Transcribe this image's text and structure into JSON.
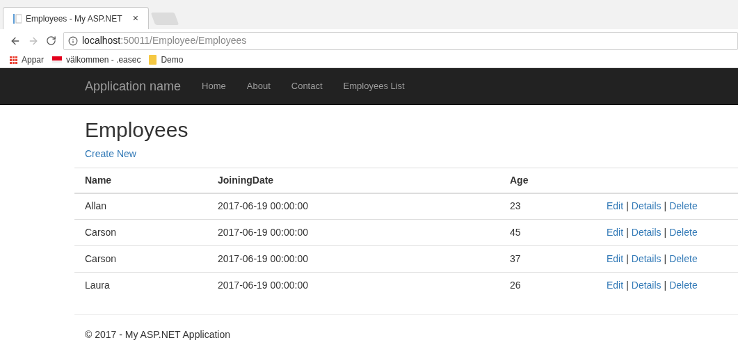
{
  "browser": {
    "tab_title": "Employees - My ASP.NET",
    "tab_close": "×",
    "address_host": "localhost",
    "address_path": ":50011/Employee/Employees",
    "bookmarks": [
      {
        "label": "Appar",
        "kind": "apps"
      },
      {
        "label": "välkommen - .easec",
        "kind": "flag"
      },
      {
        "label": "Demo",
        "kind": "folder"
      }
    ]
  },
  "navbar": {
    "brand": "Application name",
    "links": [
      "Home",
      "About",
      "Contact",
      "Employees List"
    ]
  },
  "page": {
    "title": "Employees",
    "create_link": "Create New"
  },
  "table": {
    "columns": [
      "Name",
      "JoiningDate",
      "Age"
    ],
    "rows": [
      {
        "cells": [
          "Allan",
          "2017-06-19 00:00:00",
          "23"
        ],
        "actions": [
          {
            "kind": "link",
            "text": "Edit"
          },
          {
            "kind": "separator",
            "text": "|"
          },
          {
            "kind": "link",
            "text": "Details"
          },
          {
            "kind": "separator",
            "text": "|"
          },
          {
            "kind": "link",
            "text": "Delete"
          }
        ]
      },
      {
        "cells": [
          "Carson",
          "2017-06-19 00:00:00",
          "45"
        ],
        "actions": [
          {
            "kind": "link",
            "text": "Edit"
          },
          {
            "kind": "separator",
            "text": "|"
          },
          {
            "kind": "link",
            "text": "Details"
          },
          {
            "kind": "separator",
            "text": "|"
          },
          {
            "kind": "link",
            "text": "Delete"
          }
        ]
      },
      {
        "cells": [
          "Carson",
          "2017-06-19 00:00:00",
          "37"
        ],
        "actions": [
          {
            "kind": "link",
            "text": "Edit"
          },
          {
            "kind": "separator",
            "text": "|"
          },
          {
            "kind": "link",
            "text": "Details"
          },
          {
            "kind": "separator",
            "text": "|"
          },
          {
            "kind": "link",
            "text": "Delete"
          }
        ]
      },
      {
        "cells": [
          "Laura",
          "2017-06-19 00:00:00",
          "26"
        ],
        "actions": [
          {
            "kind": "link",
            "text": "Edit"
          },
          {
            "kind": "separator",
            "text": "|"
          },
          {
            "kind": "link",
            "text": "Details"
          },
          {
            "kind": "separator",
            "text": "|"
          },
          {
            "kind": "link",
            "text": "Delete"
          }
        ]
      }
    ]
  },
  "footer": "© 2017 - My ASP.NET Application"
}
